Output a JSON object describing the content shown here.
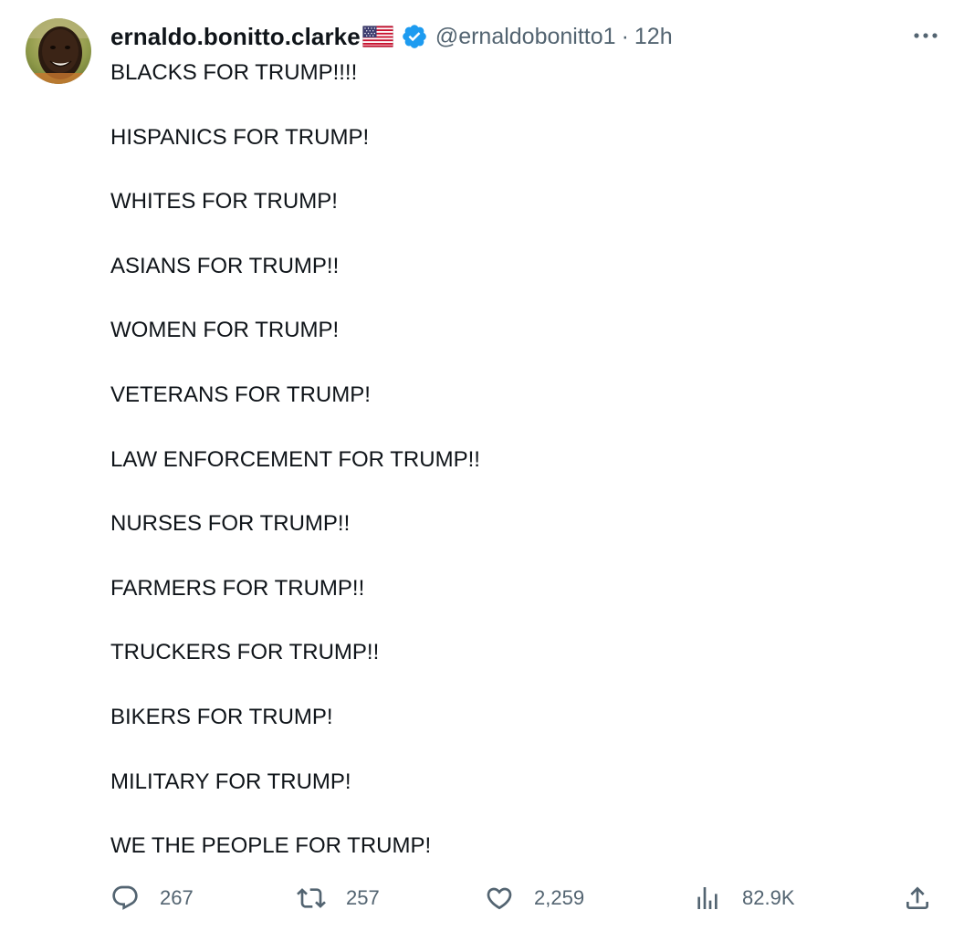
{
  "author": {
    "display_name": "ernaldo.bonitto.clarke",
    "handle": "@ernaldobonitto1",
    "separator": "·",
    "time": "12h",
    "flag_icon": "us-flag-icon",
    "verified_icon": "verified-badge-icon"
  },
  "tweet": {
    "lines": [
      "BLACKS FOR TRUMP!!!!",
      "HISPANICS FOR TRUMP!",
      "WHITES FOR TRUMP!",
      "ASIANS FOR TRUMP!!",
      "WOMEN FOR TRUMP!",
      "VETERANS FOR TRUMP!",
      "LAW ENFORCEMENT FOR TRUMP!!",
      "NURSES FOR TRUMP!!",
      "FARMERS FOR TRUMP!!",
      "TRUCKERS FOR TRUMP!!",
      "BIKERS FOR TRUMP!",
      "MILITARY FOR TRUMP!",
      "WE THE PEOPLE FOR TRUMP!"
    ]
  },
  "actions": {
    "replies": "267",
    "retweets": "257",
    "likes": "2,259",
    "views": "82.9K"
  },
  "colors": {
    "text": "#0f1419",
    "muted": "#536471",
    "verified": "#1d9bf0"
  }
}
